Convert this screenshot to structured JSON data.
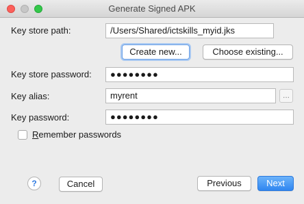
{
  "window": {
    "title": "Generate Signed APK"
  },
  "form": {
    "keystore_path_label": "Key store path:",
    "keystore_path_value": "/Users/Shared/ictskills_myid.jks",
    "create_new_label": "Create new...",
    "choose_existing_label": "Choose existing...",
    "keystore_password_label": "Key store password:",
    "keystore_password_value": "●●●●●●●●",
    "key_alias_label": "Key alias:",
    "key_alias_value": "myrent",
    "key_alias_browse_label": "...",
    "key_password_label": "Key password:",
    "key_password_value": "●●●●●●●●",
    "remember_passwords_mnemonic": "R",
    "remember_passwords_rest": "emember passwords",
    "remember_passwords_checked": false
  },
  "footer": {
    "help_label": "?",
    "cancel_label": "Cancel",
    "previous_label": "Previous",
    "next_label": "Next"
  },
  "colors": {
    "accent": "#2f86f0",
    "close": "#fc605b",
    "minimize": "#c7c7c7",
    "zoom": "#34c84a"
  }
}
